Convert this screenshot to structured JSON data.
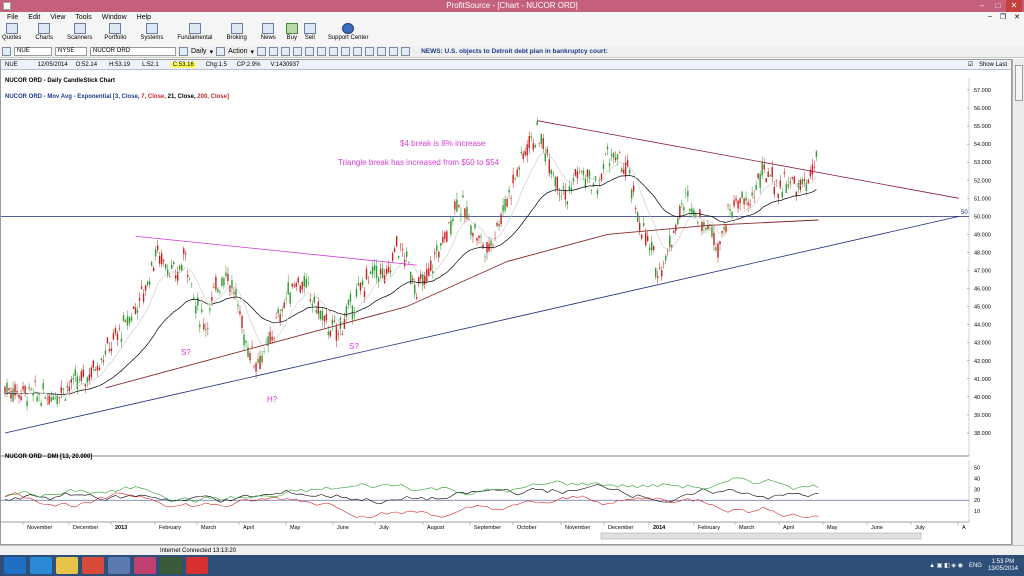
{
  "window": {
    "title": "ProfitSource - [Chart - NUCOR ORD]"
  },
  "menu": [
    "File",
    "Edit",
    "View",
    "Tools",
    "Window",
    "Help"
  ],
  "toolbar": [
    "Quotes",
    "Charts",
    "Scanners",
    "Portfolio",
    "Systems",
    "Fundamental",
    "Broking",
    "News",
    "Buy",
    "Sell",
    "Support Center"
  ],
  "symbolbar": {
    "symbol": "NUE",
    "exchange": "NYSE",
    "name": "NUCOR ORD",
    "period": "Daily",
    "action": "Action",
    "news_label": "NEWS:",
    "news_text": "U.S. objects to Detroit debt plan in bankruptcy court:"
  },
  "infobar": {
    "symbol": "NUE",
    "date": "12/05/2014",
    "open": "O:52.14",
    "high": "H:53.19",
    "low": "L:52.1",
    "close": "C:53.16",
    "change": "Chg:1.5",
    "change_pct": "CP:2.9%",
    "volume": "V:1430937",
    "show_last": "Show Last"
  },
  "chart": {
    "title": "NUCOR ORD - Daily CandleStick Chart",
    "ma_prefix": "NUCOR ORD - Mov Avg - Exponential [3, Close,",
    "ma_7": "7, Close,",
    "ma_21": "21, Close,",
    "ma_200": "200, Close]",
    "annotation_1": "$4 break is 8% increase",
    "annotation_2": "Triangle break has increased from $50 to $54",
    "label_s1": "S?",
    "label_h": "H?",
    "label_s2": "S?",
    "hline_label": "50",
    "dmi_title": "NUCOR ORD - DMI [13, 20.000]"
  },
  "chart_data": {
    "type": "line",
    "price_axis": [
      "57.000",
      "56.000",
      "55.000",
      "54.000",
      "53.000",
      "52.000",
      "51.000",
      "50.000",
      "49.000",
      "48.000",
      "47.000",
      "46.000",
      "45.000",
      "44.000",
      "43.000",
      "42.000",
      "41.000",
      "40.000",
      "39.000",
      "38.000"
    ],
    "dmi_axis": [
      "50",
      "40",
      "30",
      "20",
      "10"
    ],
    "months": [
      "November",
      "December",
      "2013",
      "February",
      "March",
      "April",
      "May",
      "June",
      "July",
      "August",
      "September",
      "October",
      "November",
      "December",
      "2014",
      "February",
      "March",
      "April",
      "May",
      "June",
      "July",
      "A"
    ],
    "price_close_approx": [
      [
        0,
        40.5
      ],
      [
        4,
        40.0
      ],
      [
        8,
        41.0
      ],
      [
        10,
        42.5
      ],
      [
        12,
        44.0
      ],
      [
        14,
        46.0
      ],
      [
        15,
        48.0
      ],
      [
        16,
        47.5
      ],
      [
        17,
        46.5
      ],
      [
        18,
        48.0
      ],
      [
        19,
        45.0
      ],
      [
        20,
        44.0
      ],
      [
        21,
        46.0
      ],
      [
        22,
        47.0
      ],
      [
        23,
        45.5
      ],
      [
        24,
        43.0
      ],
      [
        25,
        42.0
      ],
      [
        26,
        42.5
      ],
      [
        27,
        44.0
      ],
      [
        28,
        45.5
      ],
      [
        29,
        46.5
      ],
      [
        30,
        46.0
      ],
      [
        31,
        45.0
      ],
      [
        32,
        44.0
      ],
      [
        33,
        43.5
      ],
      [
        34,
        44.5
      ],
      [
        35,
        45.5
      ],
      [
        36,
        46.5
      ],
      [
        37,
        47.0
      ],
      [
        38,
        46.5
      ],
      [
        39,
        48.5
      ],
      [
        40,
        47.5
      ],
      [
        41,
        46.0
      ],
      [
        42,
        46.5
      ],
      [
        43,
        48.0
      ],
      [
        44,
        49.0
      ],
      [
        45,
        51.0
      ],
      [
        46,
        50.0
      ],
      [
        47,
        49.0
      ],
      [
        48,
        48.0
      ],
      [
        49,
        49.5
      ],
      [
        50,
        51.0
      ],
      [
        51,
        52.5
      ],
      [
        52,
        54.0
      ],
      [
        53,
        54.5
      ],
      [
        54,
        53.5
      ],
      [
        55,
        52.0
      ],
      [
        56,
        51.0
      ],
      [
        57,
        52.5
      ],
      [
        58,
        52.0
      ],
      [
        59,
        51.5
      ],
      [
        60,
        53.5
      ],
      [
        61,
        53.0
      ],
      [
        62,
        52.5
      ],
      [
        63,
        50.0
      ],
      [
        64,
        48.5
      ],
      [
        65,
        47.0
      ],
      [
        66,
        48.0
      ],
      [
        67,
        50.0
      ],
      [
        68,
        51.0
      ],
      [
        69,
        50.0
      ],
      [
        70,
        49.5
      ],
      [
        71,
        48.5
      ],
      [
        72,
        50.0
      ],
      [
        73,
        51.0
      ],
      [
        74,
        50.5
      ],
      [
        75,
        52.0
      ],
      [
        76,
        52.5
      ],
      [
        77,
        51.5
      ],
      [
        78,
        52.0
      ],
      [
        79,
        51.5
      ],
      [
        80,
        52.0
      ],
      [
        81,
        53.16
      ]
    ],
    "ema200_approx": [
      [
        10,
        40.5
      ],
      [
        20,
        42.0
      ],
      [
        30,
        43.5
      ],
      [
        40,
        45.0
      ],
      [
        50,
        47.5
      ],
      [
        60,
        49.0
      ],
      [
        70,
        49.5
      ],
      [
        81,
        49.8
      ]
    ],
    "horizontal_line": 50,
    "triangle_upper": [
      [
        53,
        55.3
      ],
      [
        95,
        51.0
      ]
    ],
    "triangle_lower": [
      [
        0,
        38.0
      ],
      [
        95,
        50.0
      ]
    ],
    "pink_resistance": [
      [
        13,
        48.9
      ],
      [
        41,
        47.3
      ]
    ],
    "dmi_lines": [
      {
        "color": "#000000"
      },
      {
        "color": "#2ca02c"
      },
      {
        "color": "#d62728"
      }
    ]
  },
  "statusbar": {
    "text": "Internet Connected 13:13:20"
  },
  "taskbar": {
    "lang": "ENG",
    "time": "1:53 PM",
    "date": "13/05/2014"
  }
}
